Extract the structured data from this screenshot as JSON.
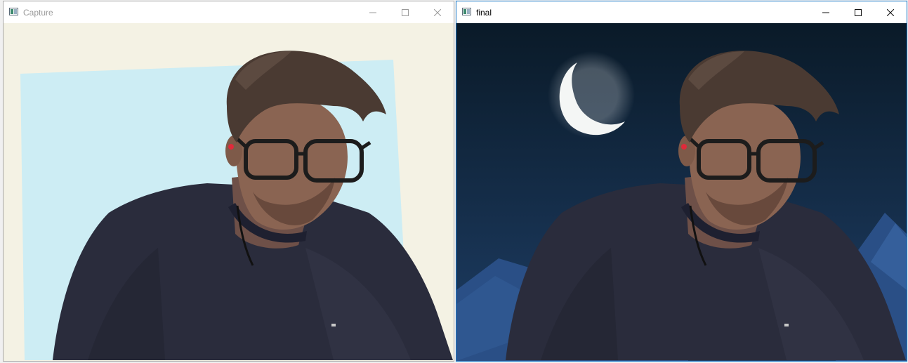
{
  "windows": [
    {
      "title": "Capture",
      "active": false,
      "content": "webcam-capture-frame"
    },
    {
      "title": "final",
      "active": true,
      "content": "background-replaced-frame"
    }
  ],
  "colors": {
    "capture_wall": "#f4f1e2",
    "capture_blue_sheet": "#c9ecf3",
    "night_sky_top": "#0a1a28",
    "night_sky_bottom": "#1e3e66",
    "mountain": "#2a4f86",
    "moon": "#f4f6f5",
    "shirt": "#2a2c3c",
    "skin": "#8a6452",
    "hair": "#4a3a32",
    "active_border": "#1b79c9"
  },
  "icons": {
    "app": "opencv-window-icon",
    "minimize": "minimize-icon",
    "maximize": "maximize-icon",
    "close": "close-icon"
  }
}
